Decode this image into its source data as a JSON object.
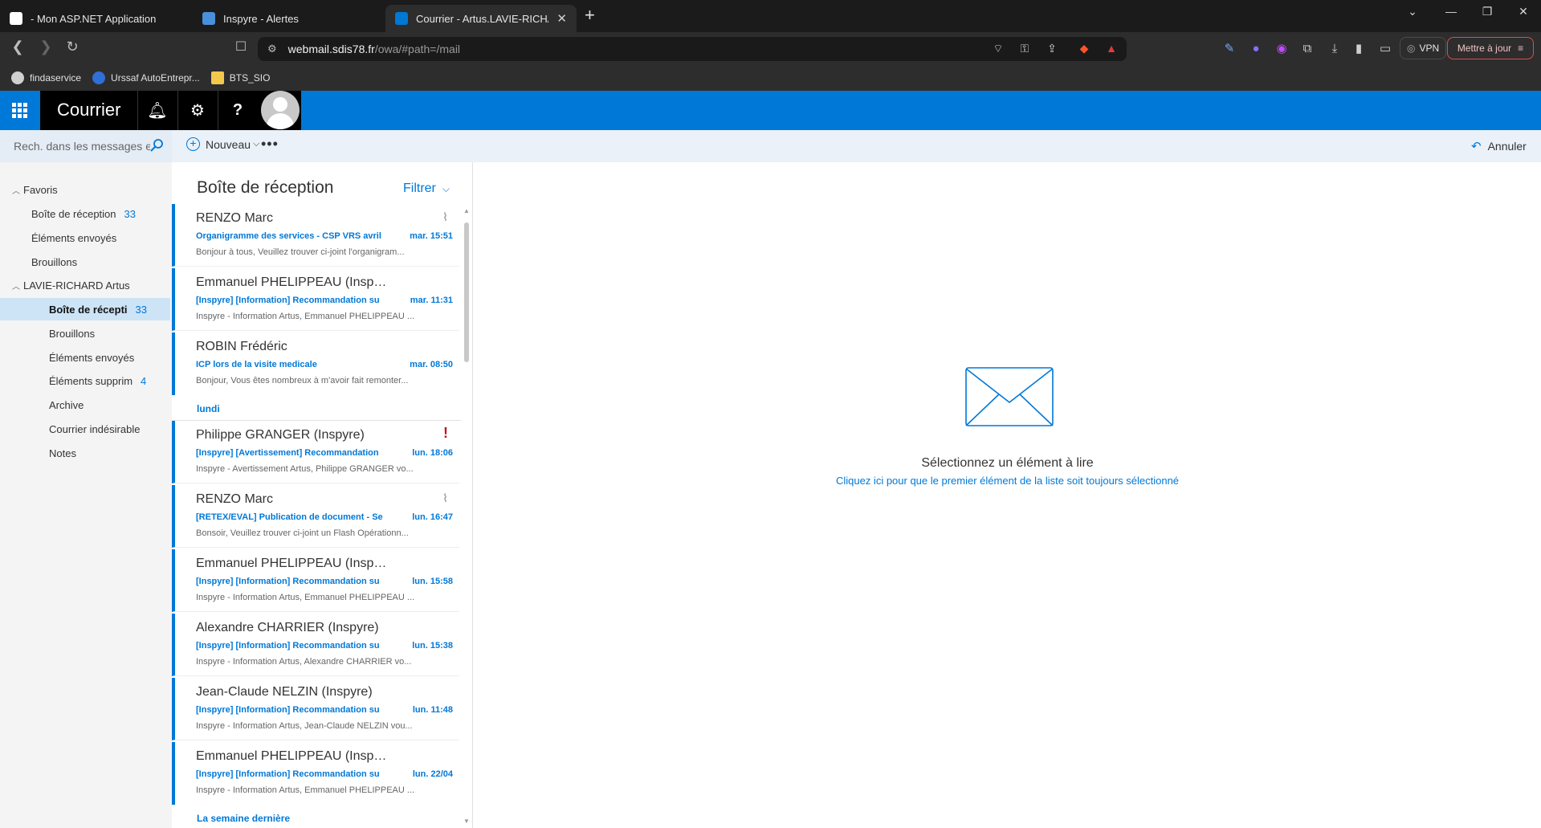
{
  "browser": {
    "tabs": [
      {
        "title": "- Mon ASP.NET Application",
        "favicon_color": "#ffffff"
      },
      {
        "title": "Inspyre - Alertes",
        "favicon_color": "#4a90d9"
      },
      {
        "title": "Courrier - Artus.LAVIE-RICHARD",
        "favicon_color": "#0078d4",
        "active": true
      }
    ],
    "url_host": "webmail.sdis78.fr",
    "url_path": "/owa/#path=/mail",
    "vpn_label": "VPN",
    "update_label": "Mettre à jour",
    "bookmarks": [
      {
        "label": "findaservice",
        "icon_color": "#d0d0d0"
      },
      {
        "label": "Urssaf AutoEntrepr...",
        "icon_color": "#2f6fd6"
      },
      {
        "label": "BTS_SIO",
        "icon_color": "#f2c94c"
      }
    ]
  },
  "owa": {
    "app_title": "Courrier",
    "brand_color": "#0078d7",
    "search_placeholder": "Rech. dans les messages e...",
    "new_label": "Nouveau",
    "undo_label": "Annuler"
  },
  "folders": {
    "favorites_header": "Favoris",
    "favorites": [
      {
        "name": "Boîte de réception",
        "count": "33"
      },
      {
        "name": "Éléments envoyés",
        "count": ""
      },
      {
        "name": "Brouillons",
        "count": ""
      }
    ],
    "account_header": "LAVIE-RICHARD Artus",
    "account_folders": [
      {
        "name": "Boîte de récepti",
        "count": "33",
        "selected": true
      },
      {
        "name": "Brouillons",
        "count": ""
      },
      {
        "name": "Éléments envoyés",
        "count": ""
      },
      {
        "name": "Éléments supprim",
        "count": "4"
      },
      {
        "name": "Archive",
        "count": ""
      },
      {
        "name": "Courrier indésirable",
        "count": ""
      },
      {
        "name": "Notes",
        "count": ""
      }
    ]
  },
  "message_list": {
    "title": "Boîte de réception",
    "filter_label": "Filtrer",
    "group_monday": "lundi",
    "group_last_week": "La semaine dernière",
    "messages": [
      {
        "from": "RENZO Marc",
        "subject": "Organigramme des services - CSP VRS avril",
        "date": "mar. 15:51",
        "preview": "Bonjour à tous, Veuillez trouver ci-joint l'organigram...",
        "icon": "attachment"
      },
      {
        "from": "Emmanuel PHELIPPEAU (Inspy...",
        "subject": "[Inspyre] [Information] Recommandation su",
        "date": "mar. 11:31",
        "preview": "Inspyre - Information Artus, Emmanuel PHELIPPEAU ...",
        "icon": ""
      },
      {
        "from": "ROBIN Frédéric",
        "subject": "ICP lors de la visite medicale",
        "date": "mar. 08:50",
        "preview": "Bonjour, Vous êtes nombreux à m'avoir fait remonter...",
        "icon": ""
      },
      {
        "from": "Philippe GRANGER (Inspyre)",
        "subject": "[Inspyre] [Avertissement] Recommandation",
        "date": "lun. 18:06",
        "preview": "Inspyre - Avertissement Artus, Philippe GRANGER vo...",
        "icon": "urgent"
      },
      {
        "from": "RENZO Marc",
        "subject": "[RETEX/EVAL] Publication de document - Se",
        "date": "lun. 16:47",
        "preview": "Bonsoir, Veuillez trouver ci-joint un Flash Opérationn...",
        "icon": "attachment"
      },
      {
        "from": "Emmanuel PHELIPPEAU (Inspy...",
        "subject": "[Inspyre] [Information] Recommandation su",
        "date": "lun. 15:58",
        "preview": "Inspyre - Information Artus, Emmanuel PHELIPPEAU ...",
        "icon": ""
      },
      {
        "from": "Alexandre CHARRIER (Inspyre)",
        "subject": "[Inspyre] [Information] Recommandation su",
        "date": "lun. 15:38",
        "preview": "Inspyre - Information Artus, Alexandre CHARRIER vo...",
        "icon": ""
      },
      {
        "from": "Jean-Claude NELZIN (Inspyre)",
        "subject": "[Inspyre] [Information] Recommandation su",
        "date": "lun. 11:48",
        "preview": "Inspyre - Information Artus, Jean-Claude NELZIN vou...",
        "icon": ""
      },
      {
        "from": "Emmanuel PHELIPPEAU (Inspy...",
        "subject": "[Inspyre] [Information] Recommandation su",
        "date": "lun. 22/04",
        "preview": "Inspyre - Information Artus, Emmanuel PHELIPPEAU ...",
        "icon": ""
      }
    ]
  },
  "reading_pane": {
    "empty_title": "Sélectionnez un élément à lire",
    "empty_link": "Cliquez ici pour que le premier élément de la liste soit toujours sélectionné"
  }
}
